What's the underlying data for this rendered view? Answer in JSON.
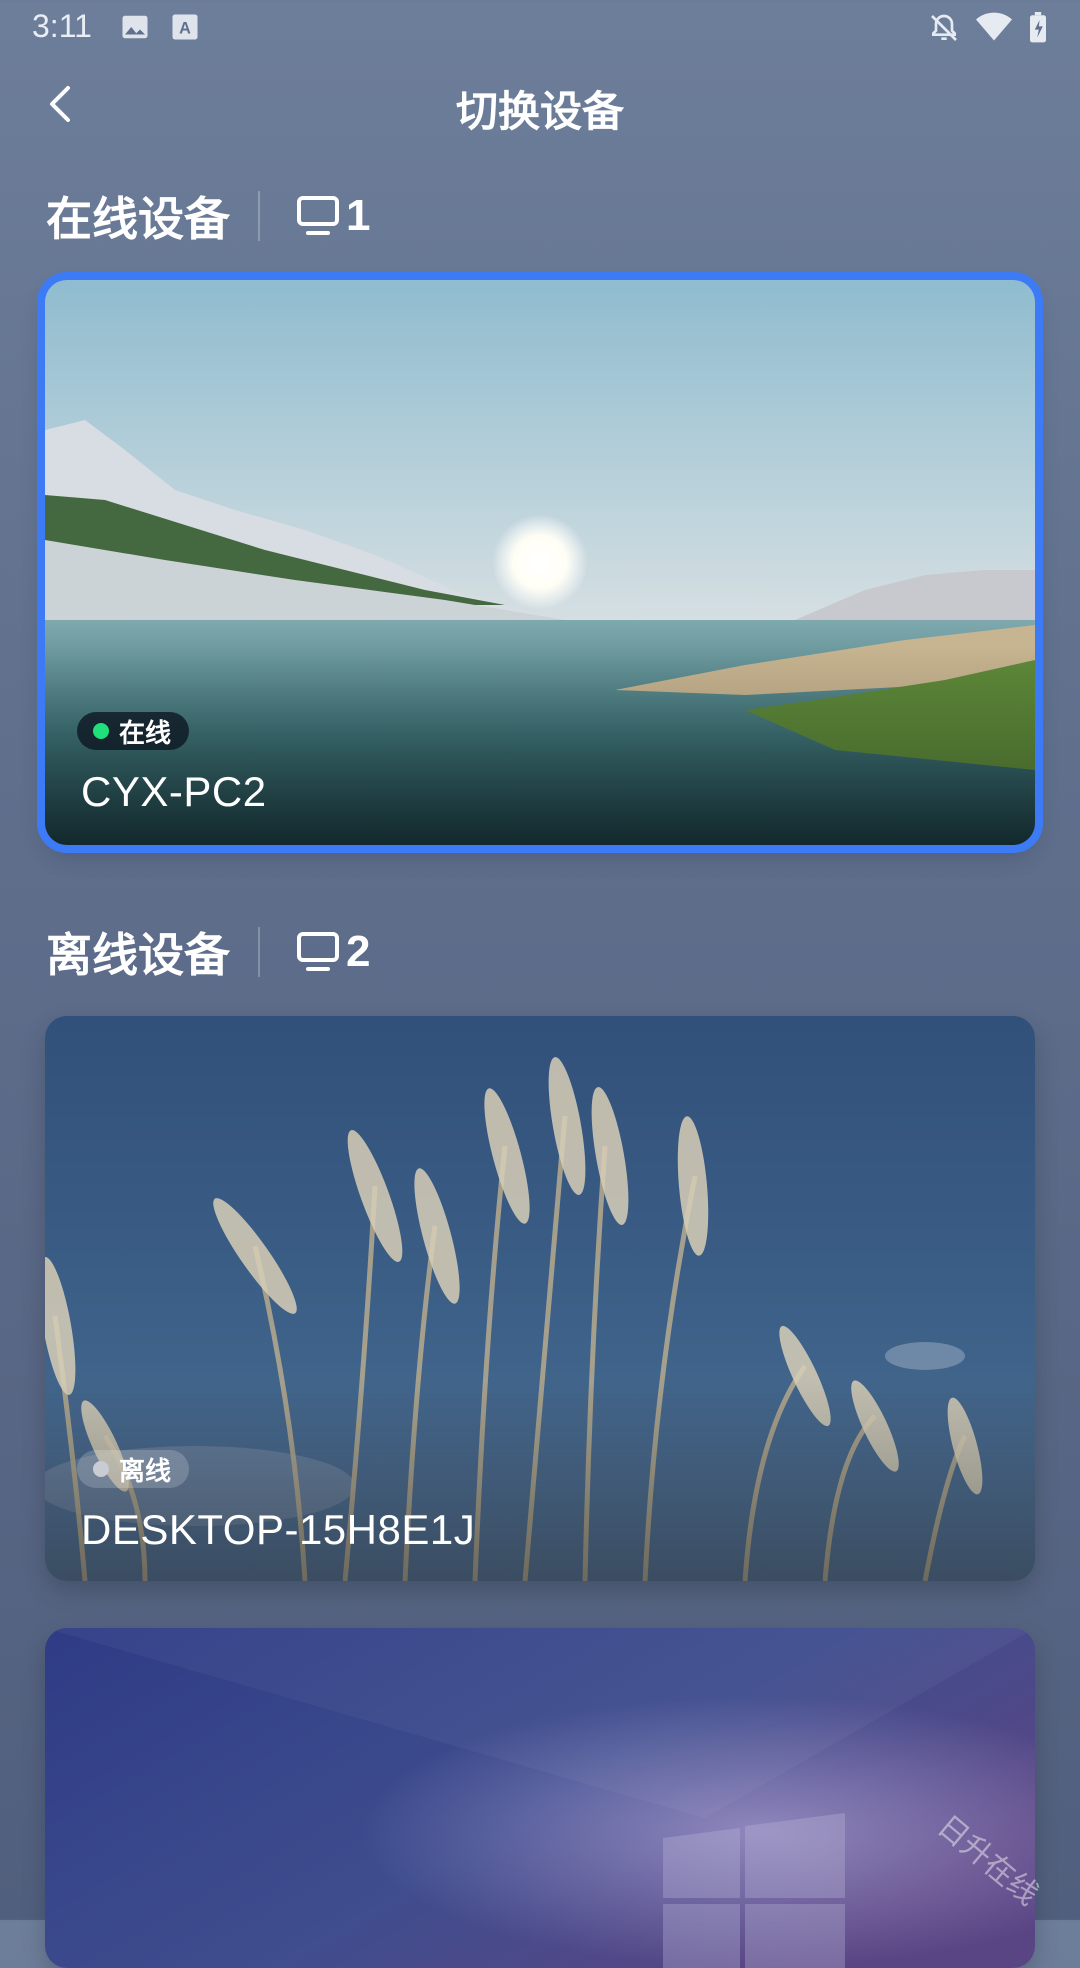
{
  "status_bar": {
    "time": "3:11",
    "left_icons": [
      "image-icon",
      "font-download-icon"
    ],
    "right_icons": [
      "bell-off-icon",
      "wifi-icon",
      "battery-charging-icon"
    ]
  },
  "header": {
    "title": "切换设备",
    "back_icon": "chevron-left-icon"
  },
  "online_section": {
    "title": "在线设备",
    "count_icon": "monitor-icon",
    "count": "1",
    "devices": [
      {
        "name": "CYX-PC2",
        "status": "在线",
        "selected": true,
        "status_color": "#1fe07a"
      }
    ]
  },
  "offline_section": {
    "title": "离线设备",
    "count_icon": "monitor-icon",
    "count": "2",
    "devices": [
      {
        "name": "DESKTOP-15H8E1J",
        "status": "离线",
        "status_color": "#c9ccd3"
      },
      {
        "name": "",
        "status": ""
      }
    ]
  },
  "watermark": "日升在线",
  "colors": {
    "accent": "#3d7bf6",
    "online": "#1fe07a"
  }
}
